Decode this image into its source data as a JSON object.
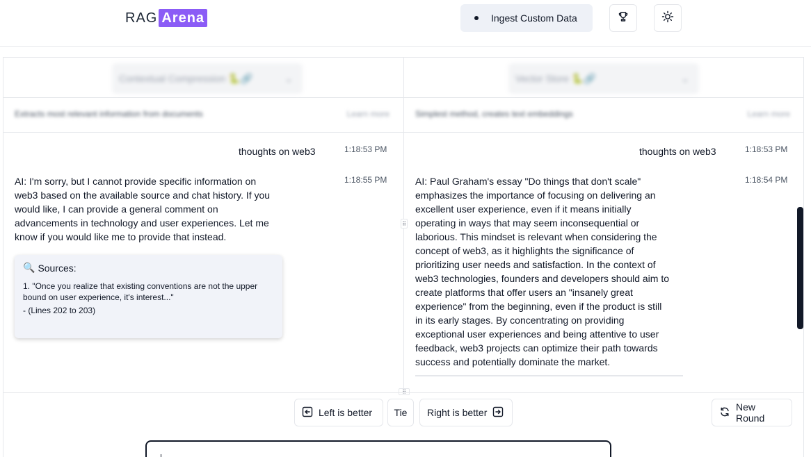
{
  "header": {
    "logo_rag": "RAG",
    "logo_arena": "Arena",
    "ingest_label": "Ingest Custom Data",
    "trophy_icon": "trophy-icon",
    "theme_icon": "sun-icon"
  },
  "left": {
    "method": "Contextual Compression 🐍🔗",
    "description": "Extracts most relevant information from documents",
    "learn_more": "Learn more",
    "user_message": "thoughts on web3",
    "user_time": "1:18:53 PM",
    "ai_time": "1:18:55 PM",
    "ai_lines": [
      "AI: I'm sorry, but I cannot provide specific information on",
      "web3 based on the available source and chat history. If you",
      "would like, I can provide a general comment on",
      "advancements in technology and user experiences. Let me",
      "know if you would like me to provide that instead."
    ],
    "sources_title": "Sources:",
    "source_lines": [
      "1. \"Once you realize that existing conventions are not the upper",
      "bound on user experience, it's interest...\"",
      "- (Lines 202 to 203)"
    ]
  },
  "right": {
    "method": "Vector Store 🐍🔗",
    "description": "Simplest method, creates text embeddings",
    "learn_more": "Learn more",
    "user_message": "thoughts on web3",
    "user_time": "1:18:53 PM",
    "ai_time": "1:18:54 PM",
    "ai_lines": [
      "AI: Paul Graham's essay \"Do things that don't scale\"",
      "emphasizes the importance of focusing on delivering an",
      "excellent user experience, even if it means initially",
      "operating in ways that may seem inconsequential or",
      "laborious. This mindset is relevant when considering the",
      "concept of web3, as it highlights the significance of",
      "prioritizing user needs and satisfaction. In the context of",
      "web3 technologies, founders and developers should aim to",
      "create platforms that offer users an \"insanely great",
      "experience\" from the beginning, even if the product is still",
      "in its early stages. By concentrating on providing",
      "exceptional user experiences and being attentive to user",
      "feedback, web3 projects can optimize their path towards",
      "success and potentially dominate the market."
    ]
  },
  "votes": {
    "left_label": "Left is better",
    "tie_label": "Tie",
    "right_label": "Right is better",
    "new_round_label": "New Round"
  },
  "colors": {
    "accent": "#8b5cf6",
    "scrollbar": "#111827"
  }
}
